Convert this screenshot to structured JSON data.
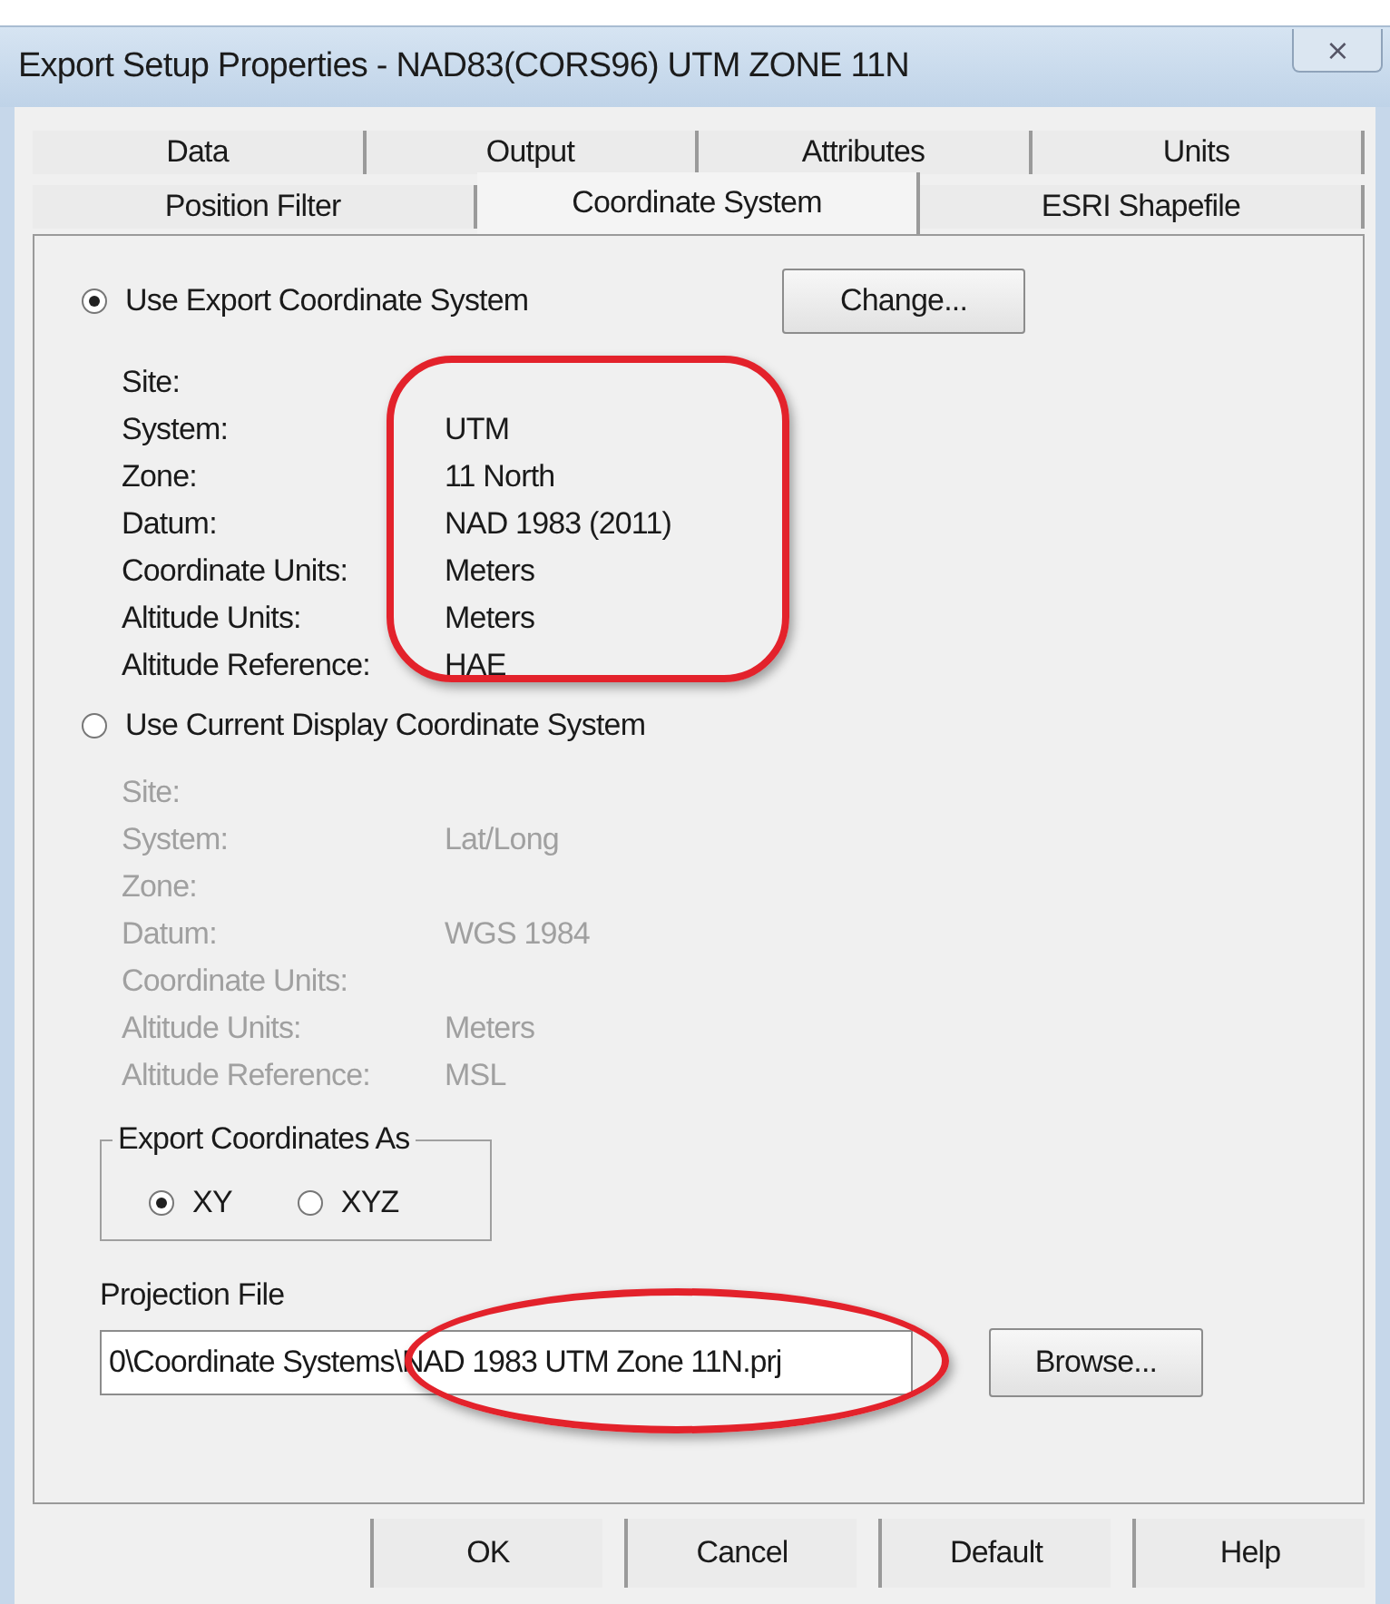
{
  "window": {
    "title": "Export Setup Properties - NAD83(CORS96) UTM ZONE 11N",
    "close": "⨯"
  },
  "tab_rows": [
    [
      {
        "label": "Data",
        "selected": false
      },
      {
        "label": "Output",
        "selected": false
      },
      {
        "label": "Attributes",
        "selected": false
      },
      {
        "label": "Units",
        "selected": false
      }
    ],
    [
      {
        "label": "Position Filter",
        "selected": false
      },
      {
        "label": "Coordinate System",
        "selected": true
      },
      {
        "label": "ESRI Shapefile",
        "selected": false
      }
    ]
  ],
  "sections": [
    {
      "option": "Use Export Coordinate System",
      "selected": true,
      "disabled": false,
      "highlighted": true,
      "button": "Change...",
      "rows": [
        {
          "label": "Site:"
        },
        {
          "label": "System:",
          "value": "UTM"
        },
        {
          "label": "Zone:",
          "value": "11 North"
        },
        {
          "label": "Datum:",
          "value": "NAD 1983 (2011)"
        },
        {
          "label": "Coordinate Units:",
          "value": "Meters"
        },
        {
          "label": "Altitude Units:",
          "value": "Meters"
        },
        {
          "label": "Altitude Reference:",
          "value": "HAE"
        }
      ]
    },
    {
      "option": "Use Current Display Coordinate System",
      "selected": false,
      "disabled": true,
      "highlighted": false,
      "rows": [
        {
          "label": "Site:"
        },
        {
          "label": "System:",
          "value": "Lat/Long"
        },
        {
          "label": "Zone:"
        },
        {
          "label": "Datum:",
          "value": "WGS 1984"
        },
        {
          "label": "Coordinate Units:"
        },
        {
          "label": "Altitude Units:",
          "value": "Meters"
        },
        {
          "label": "Altitude Reference:",
          "value": "MSL"
        }
      ]
    }
  ],
  "export_as": {
    "title": "Export Coordinates As",
    "options": [
      {
        "label": "XY",
        "selected": true
      },
      {
        "label": "XYZ",
        "selected": false
      }
    ]
  },
  "projection_file": {
    "label": "Projection File",
    "value": "0\\Coordinate Systems\\NAD 1983 UTM Zone 11N.prj",
    "highlighted": true,
    "button": "Browse..."
  },
  "buttons": [
    "OK",
    "Cancel",
    "Default",
    "Help"
  ]
}
